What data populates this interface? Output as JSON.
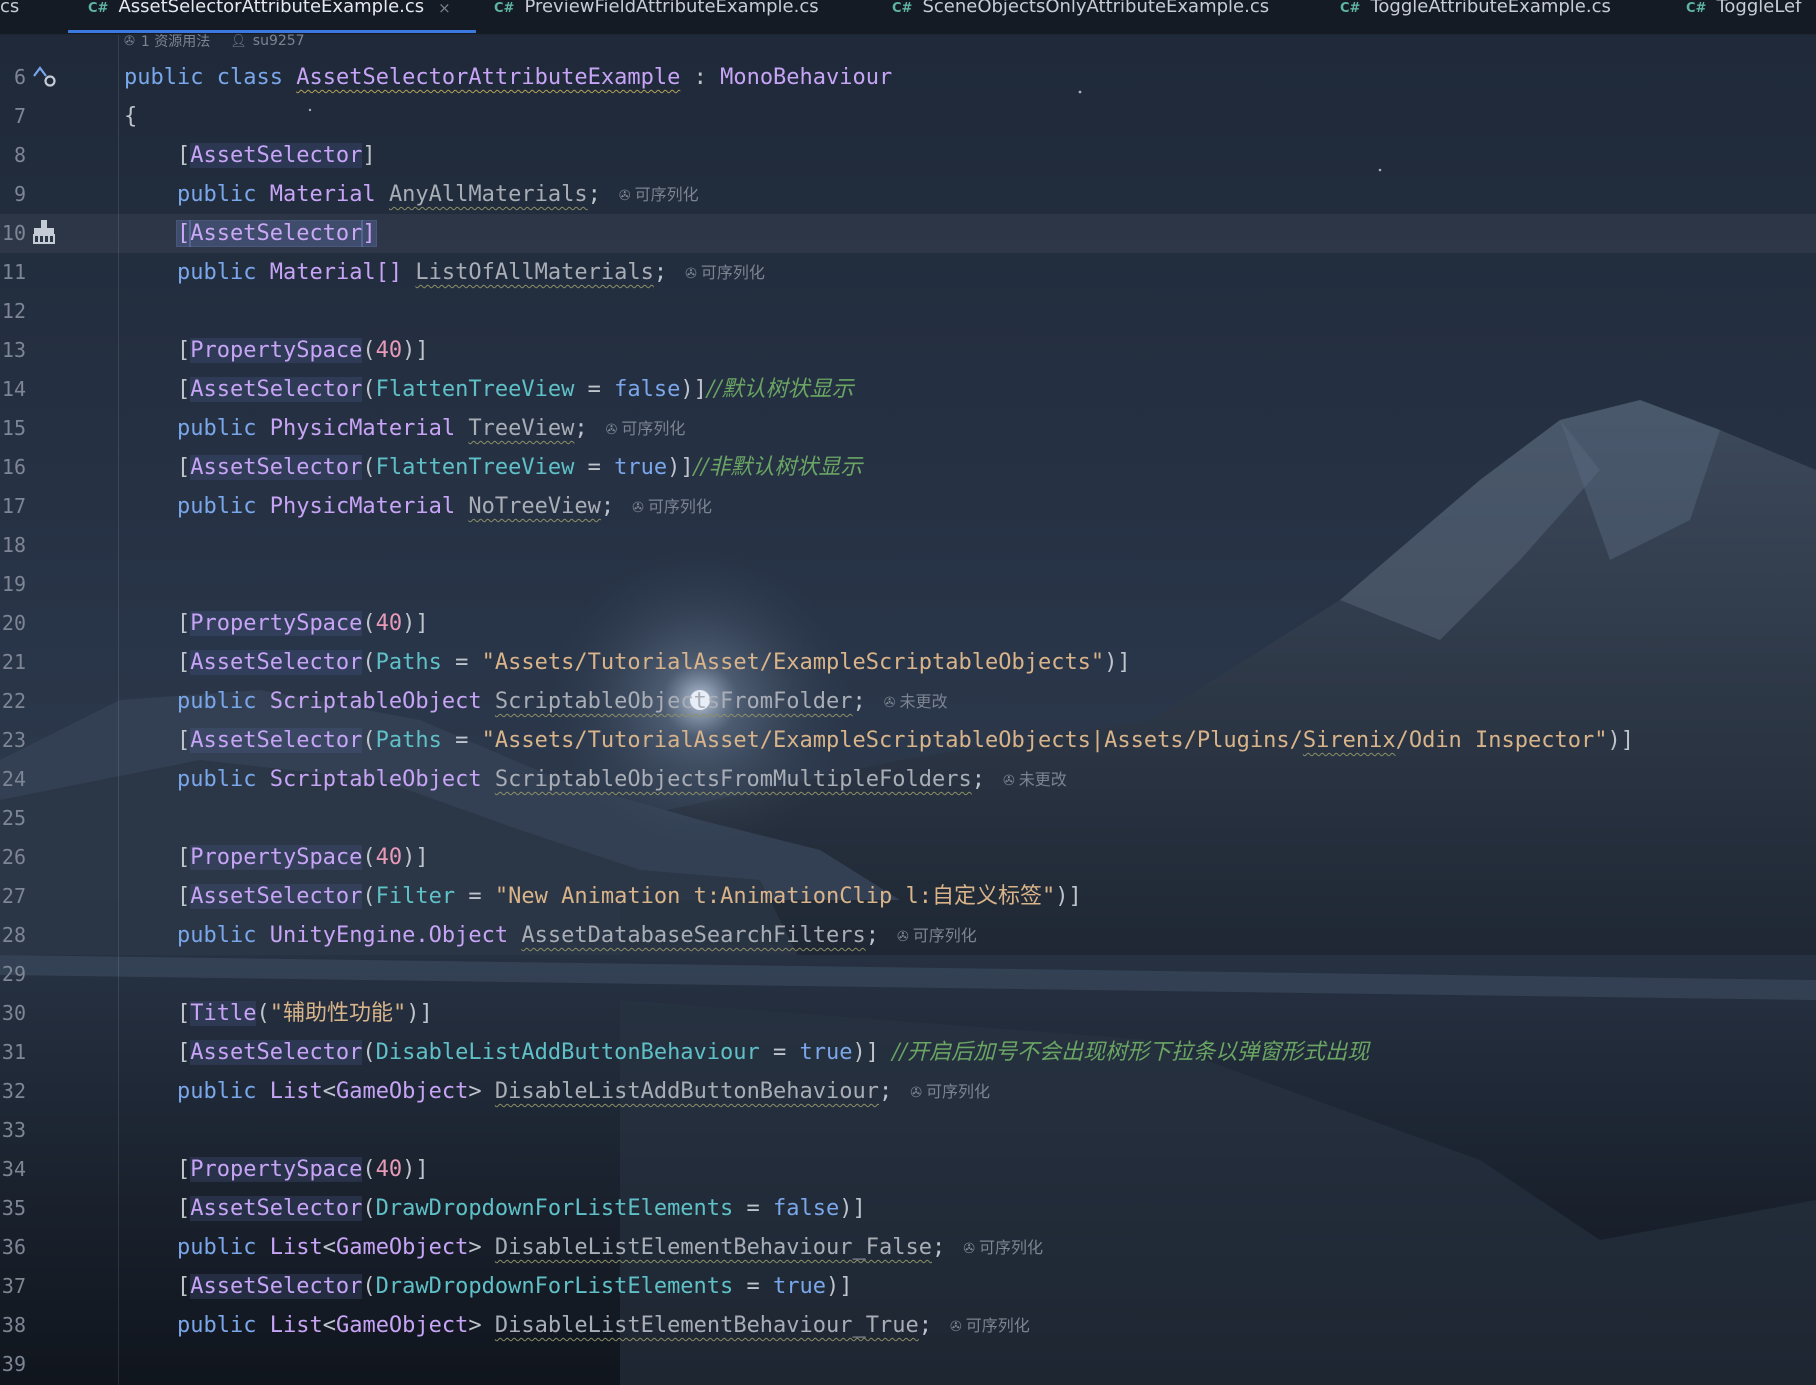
{
  "tabs": [
    {
      "lang": "C#",
      "label": "AssetSelectorAttributeExample.cs",
      "active": true,
      "close": "×"
    },
    {
      "lang": "C#",
      "label": "PreviewFieldAttributeExample.cs"
    },
    {
      "lang": "C#",
      "label": "SceneObjectsOnlyAttributeExample.cs"
    },
    {
      "lang": "C#",
      "label": "ToggleAttributeExample.cs"
    },
    {
      "lang": "C#",
      "label": "ToggleLef"
    }
  ],
  "left_partial_tab": "cs",
  "usage_hint": {
    "usages": "1 资源用法",
    "author": "su9257"
  },
  "hints": {
    "serializable": "可序列化",
    "unchanged": "未更改"
  },
  "code": {
    "kw_public": "public",
    "kw_class": "class",
    "kw_false": "false",
    "kw_true": "true",
    "class_name": "AssetSelectorAttributeExample",
    "colon": ":",
    "base_class": "MonoBehaviour",
    "open_brace": "{",
    "attr_asset_selector": "AssetSelector",
    "attr_property_space": "PropertySpace",
    "attr_title": "Title",
    "num_40": "40",
    "t_material": "Material",
    "t_material_array": "Material[]",
    "t_physic_material": "PhysicMaterial",
    "t_scriptable_object": "ScriptableObject",
    "t_unity_object": "UnityEngine.Object",
    "t_list": "List",
    "t_game_object": "GameObject",
    "p_flatten": "FlattenTreeView",
    "p_paths": "Paths",
    "p_filter": "Filter",
    "p_disable_add": "DisableListAddButtonBehaviour",
    "p_draw_dropdown": "DrawDropdownForListElements",
    "f_any_all": "AnyAllMaterials",
    "f_list_all": "ListOfAllMaterials",
    "f_tree": "TreeView",
    "f_no_tree": "NoTreeView",
    "f_from_folder": "ScriptableObjectsFromFolder",
    "f_from_multi": "ScriptableObjectsFromMultipleFolders",
    "f_filters": "AssetDatabaseSearchFilters",
    "f_disable_add": "DisableListAddButtonBehaviour",
    "f_elem_false": "DisableListElementBehaviour_False",
    "f_elem_true": "DisableListElementBehaviour_True",
    "s_path1": "\"Assets/TutorialAsset/ExampleScriptableObjects\"",
    "s_path2a": "\"Assets/TutorialAsset/ExampleScriptableObjects|Assets/Plugins/",
    "s_path2b": "Sirenix",
    "s_path2c": "/Odin Inspector\"",
    "s_filter": "\"New Animation t:AnimationClip l:自定义标签\"",
    "s_title": "\"辅助性功能\"",
    "c_tree_default": "//默认树状显示",
    "c_tree_non": "//非默认树状显示",
    "c_add_button": "//开启后加号不会出现树形下拉条以弹窗形式出现"
  },
  "line_numbers": [
    "6",
    "7",
    "8",
    "9",
    "10",
    "11",
    "12",
    "13",
    "14",
    "15",
    "16",
    "17",
    "18",
    "19",
    "20",
    "21",
    "22",
    "23",
    "24",
    "25",
    "26",
    "27",
    "28",
    "29",
    "30",
    "31",
    "32",
    "33",
    "34",
    "35",
    "36",
    "37",
    "38",
    "39"
  ]
}
